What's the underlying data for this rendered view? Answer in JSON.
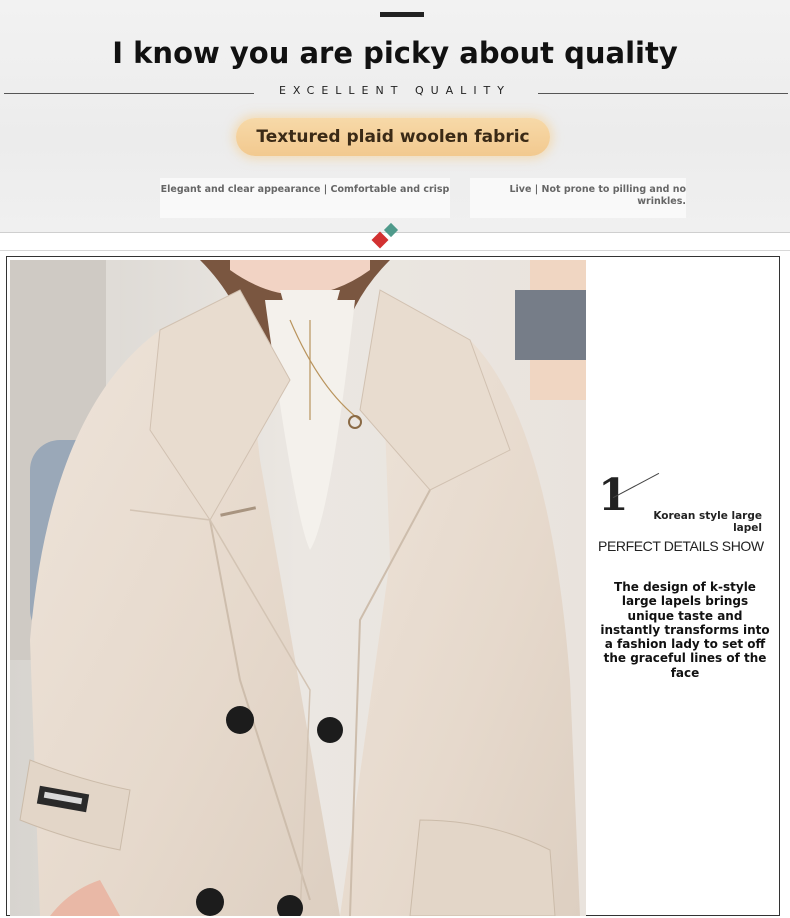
{
  "header": {
    "headline": "I know you are picky about quality",
    "subtitle": "EXCELLENT QUALITY",
    "badge": "Textured plaid woolen fabric",
    "note_left": "Elegant and clear appearance | Comfortable and crisp",
    "note_right": "Live | Not prone to pilling and no wrinkles."
  },
  "feature": {
    "number": "1",
    "title": "Korean style large lapel",
    "tagline": "PERFECT DETAILS SHOW",
    "description": "The design of k-style large lapels brings unique taste and instantly transforms into a fashion lady to set off the graceful lines of the face"
  },
  "colors": {
    "badge_bg": "#f2c98f",
    "coat": "#e9ddd0",
    "accent_red": "#d23131",
    "accent_teal": "#4f9a8b"
  }
}
